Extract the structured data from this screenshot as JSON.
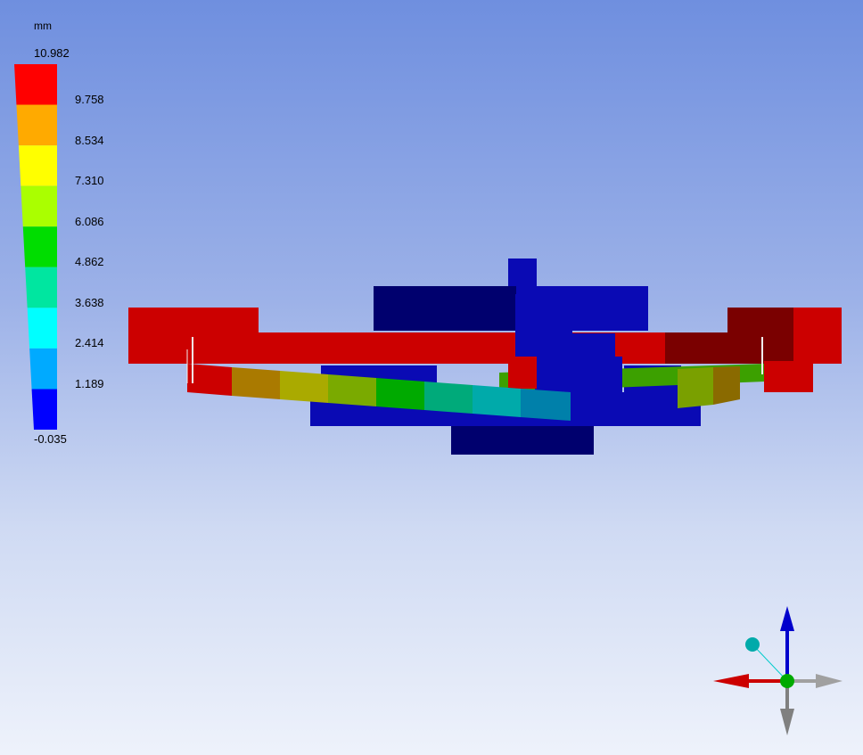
{
  "legend": {
    "unit": "mm",
    "max_label": "10.982",
    "min_label": "-0.035",
    "ticks": [
      "9.758",
      "8.534",
      "7.310",
      "6.086",
      "4.862",
      "3.638",
      "2.414",
      "1.189"
    ],
    "band_colors": [
      "#ff0000",
      "#ffaa00",
      "#ffff00",
      "#aaff00",
      "#00dd00",
      "#00e6a0",
      "#00ffff",
      "#00aaff",
      "#0000ff"
    ]
  },
  "model_colors": {
    "red": "#cc0000",
    "dark_red": "#7a0000",
    "blue": "#0a0ab4",
    "dark_blue": "#00006e"
  },
  "triad": {
    "x_axis_color": "#cc0000",
    "y_axis_color": "#0000cc",
    "z_axis_color": "#808080",
    "origin_color": "#00aa00",
    "iso_ball_color": "#00aaaa"
  }
}
